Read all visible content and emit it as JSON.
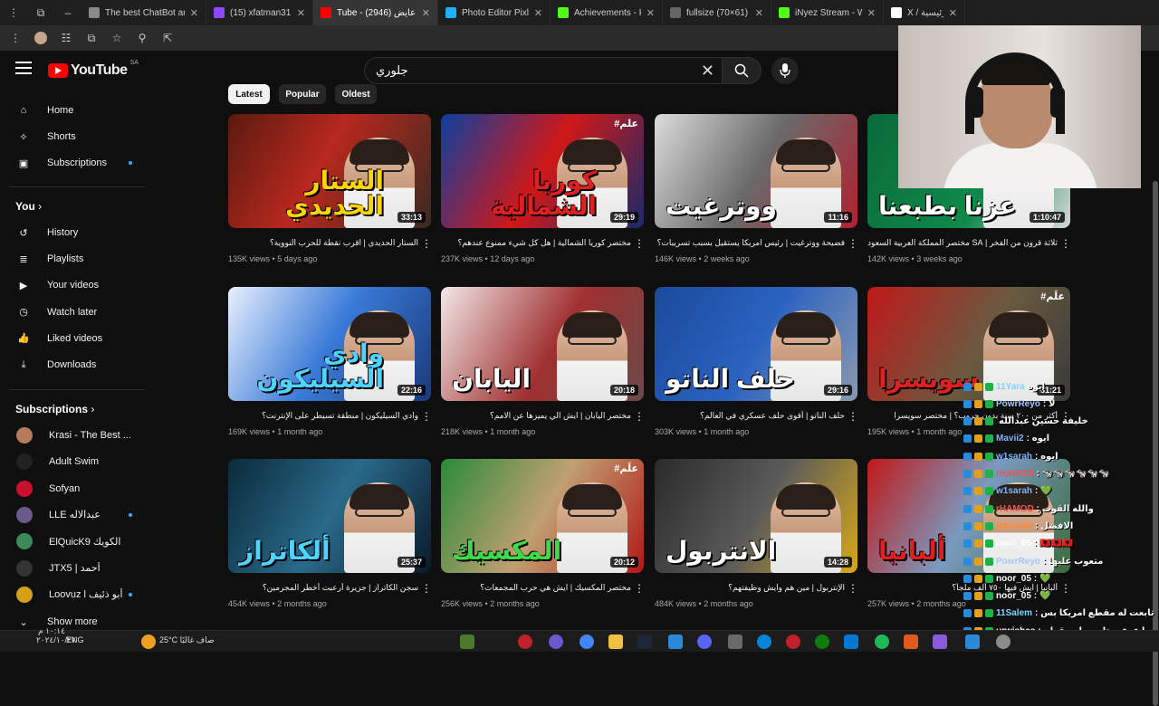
{
  "browser": {
    "tabs": [
      {
        "title": "The best ChatBot and Wr...",
        "color": "#8a8a8a",
        "active": false
      },
      {
        "title": "(15) xfatman31 - Clips M...",
        "color": "#9146ff",
        "active": false
      },
      {
        "title": "Tube - د.أبو عايض (2946)",
        "color": "#ff0000",
        "active": true
      },
      {
        "title": "Photo Editor Pixlr Free on...",
        "color": "#1fb0ff",
        "active": false
      },
      {
        "title": "Achievements - Kick Dash...",
        "color": "#53fc18",
        "active": false
      },
      {
        "title": "fullsize (70×61)",
        "color": "#666666",
        "active": false
      },
      {
        "title": "iNyez Stream - Watch Live...",
        "color": "#53fc18",
        "active": false
      },
      {
        "title": "X / الرئيسية",
        "color": "#ffffff",
        "active": false
      }
    ]
  },
  "youtube": {
    "logo": "YouTube",
    "country": "SA",
    "search_query": "جلوري",
    "chips": [
      "Latest",
      "Popular",
      "Oldest"
    ]
  },
  "sidebar": {
    "main": [
      "Home",
      "Shorts",
      "Subscriptions"
    ],
    "you_heading": "You",
    "you_items": [
      "History",
      "Playlists",
      "Your videos",
      "Watch later",
      "Liked videos",
      "Downloads"
    ],
    "subs_heading": "Subscriptions",
    "subs": [
      {
        "name": "Krasi - The Best ...",
        "color": "#b57a5a"
      },
      {
        "name": "Adult Swim",
        "color": "#222222"
      },
      {
        "name": "Sofyan",
        "color": "#c8102e"
      },
      {
        "name": "LLE عبدالاله",
        "color": "#6a5a8a"
      },
      {
        "name": "ElQuicK9 الكويك",
        "color": "#3a8a5a"
      },
      {
        "name": "JTX5 | أحمد",
        "color": "#333333"
      },
      {
        "name": "Loovuz l أبو ذئيف",
        "color": "#d4a017"
      }
    ],
    "show_more": "Show more"
  },
  "videos": [
    {
      "thumb_text": "الستار الحديدي",
      "title": "الستار الحديدي | اقرب نقطة للحرب النووية؟",
      "views": "135K views",
      "age": "5 days ago",
      "duration": "33:13",
      "style": "yellow",
      "bg": "linear-gradient(120deg,#5a1a10,#b8281e 45%,#3a2a20)"
    },
    {
      "thumb_text": "كوريا الشمالية",
      "title": "مختصر كوريا الشمالية | هل كل شيء ممنوع عندهم؟",
      "views": "237K views",
      "age": "12 days ago",
      "duration": "29:19",
      "style": "red",
      "bg": "linear-gradient(120deg,#0b3fa0,#d01818 50%,#1a2a6a)",
      "hash": "#علم"
    },
    {
      "thumb_text": "ووترغيت",
      "title": "فضيحة ووترغيت | رئيس امريكا يستقيل بسبب تسريبات؟",
      "views": "146K views",
      "age": "2 weeks ago",
      "duration": "11:16",
      "style": "",
      "bg": "linear-gradient(120deg,#dcdcdc,#6a6a6a 50%,#b02030)"
    },
    {
      "thumb_text": "عزنا بطبعنا",
      "title": "ثلاثة قرون من الفخر | SA مختصر المملكة العربية السعودية",
      "views": "142K views",
      "age": "3 weeks ago",
      "duration": "1:10:47",
      "style": "",
      "bg": "linear-gradient(120deg,#0a6a3a,#0f8a4a 60%,#d8d8d8)"
    },
    {
      "thumb_text": "وادي السيليكون",
      "title": "وادي السيليكون | منطقة تسيطر على الإنترنت؟",
      "views": "169K views",
      "age": "1 month ago",
      "duration": "22:16",
      "style": "cyan",
      "bg": "linear-gradient(120deg,#e8f0ff,#3a7ad8 50%,#1a3a7a)"
    },
    {
      "thumb_text": "اليابان",
      "title": "مختصر اليابان | ايش الي يميزها عن الامم؟",
      "views": "218K views",
      "age": "1 month ago",
      "duration": "20:18",
      "style": "",
      "bg": "linear-gradient(120deg,#f3e8e8,#a03030 55%,#6a4a4a)"
    },
    {
      "thumb_text": "حلف الناتو",
      "title": "حلف الناتو | أقوى حلف عسكري في العالم؟",
      "views": "303K views",
      "age": "1 month ago",
      "duration": "29:16",
      "style": "",
      "bg": "linear-gradient(120deg,#1a4a9a,#2a62c0 50%,#8a98b0)"
    },
    {
      "thumb_text": "سويسرا",
      "title": "أكثر من ٢٠٠ سنة بدون حروب؟ | مختصر سويسرا",
      "views": "195K views",
      "age": "1 month ago",
      "duration": "31:21",
      "style": "red",
      "bg": "linear-gradient(120deg,#c01818,#6a5a40 55%,#3a3a3a)",
      "hash": "#علَم"
    },
    {
      "thumb_text": "ألكاتراز",
      "title": "سجن الكاتراز | جزيرة أرعبت أخطر المجرمين؟",
      "views": "454K views",
      "age": "2 months ago",
      "duration": "25:37",
      "style": "cyan",
      "bg": "linear-gradient(120deg,#0a2a3a,#2a6a8a 50%,#0a1a2a)"
    },
    {
      "thumb_text": "المكسيك",
      "title": "مختصر المكسيك | ايش هي حرب المجمعات؟",
      "views": "256K views",
      "age": "2 months ago",
      "duration": "20:12",
      "style": "green",
      "bg": "linear-gradient(120deg,#2a8a3a,#c0a070 50%,#b01818)",
      "hash": "#علَم"
    },
    {
      "thumb_text": "الانتربول",
      "title": "الإنتربول | مين هم وايش وظيفتهم؟",
      "views": "484K views",
      "age": "2 months ago",
      "duration": "14:28",
      "style": "",
      "bg": "linear-gradient(120deg,#2a2a2a,#5a5a5a 50%,#d8a818)"
    },
    {
      "thumb_text": "ألبانيا",
      "title": "ألبانيا | ايش فيها ٧٥٠ ألف ملجأ؟",
      "views": "257K views",
      "age": "2 months ago",
      "duration": "",
      "style": "red",
      "bg": "linear-gradient(120deg,#c01818,#7a9ac0 50%,#3a6a3a)"
    }
  ],
  "chat": [
    {
      "user": "11Yara",
      "text": "ايوه",
      "ucolor": "#7fd3ff"
    },
    {
      "user": "PowrReyo",
      "text": ": لا",
      "ucolor": "#a0c8ff"
    },
    {
      "user": "",
      "text": "خليفة حسين عبدالله",
      "ucolor": "#ffffff"
    },
    {
      "user": "Mavii2",
      "text": ": ايوه",
      "ucolor": "#7fb3ff"
    },
    {
      "user": "w1sarah",
      "text": ": ايوه",
      "ucolor": "#7fb3ff"
    },
    {
      "user": "rHAMOD",
      "text": ": 🐄🐄🐄🐄🐄🐄",
      "ucolor": "#ff4a4a"
    },
    {
      "user": "w1sarah",
      "text": ": 💚",
      "ucolor": "#7fb3ff"
    },
    {
      "user": "rHAMOD",
      "text": ": والله القوت",
      "ucolor": "#ff4a4a"
    },
    {
      "user": "w1sarah",
      "text": ": الافضل",
      "ucolor": "#ff8a3a"
    },
    {
      "user": "noor_05",
      "text": ": 🇦🇱🇦🇱🇦🇱",
      "ucolor": "#ffffff"
    },
    {
      "user": "PowrReyo",
      "text": ": متعوب عليها",
      "ucolor": "#a0c8ff"
    },
    {
      "user": "noor_05",
      "text": ": 💚",
      "ucolor": "#ffffff"
    },
    {
      "user": "noor_05",
      "text": ": 💚",
      "ucolor": "#ffffff"
    },
    {
      "user": "11Salem",
      "text": ": تابعت له مقطع امريكا بس",
      "ucolor": "#7fd3ff"
    },
    {
      "user": "urwishes",
      "text": ": ما عرفت تابعت له مقطع",
      "ucolor": "#ffffff"
    }
  ],
  "taskbar": {
    "weather": "25°C صاف غالبًا",
    "lang": "ENG",
    "time": "١٠:١٤ م",
    "date": "٢٠٢٤/١٠/٢٧"
  }
}
